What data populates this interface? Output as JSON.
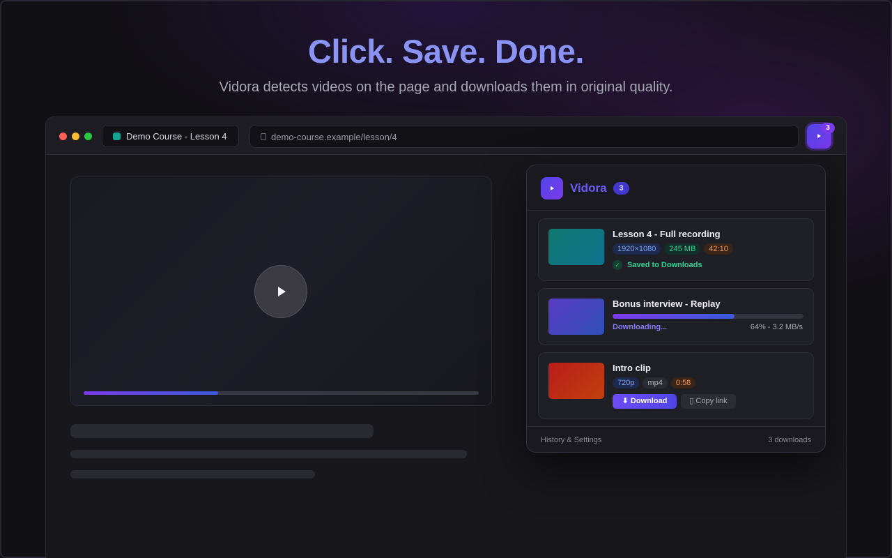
{
  "hero": {
    "title": "Click. Save. Done.",
    "subtitle": "Vidora detects videos on the page and downloads them in original quality."
  },
  "browser": {
    "tab_title": "Demo Course - Lesson 4",
    "url": "demo-course.example/lesson/4",
    "extension_badge": "3"
  },
  "player": {
    "progress_fraction": 0.34
  },
  "popup": {
    "brand": "Vidora",
    "count": "3",
    "items": [
      {
        "title": "Lesson 4 - Full recording",
        "resolution": "1920×1080",
        "size": "245 MB",
        "duration": "42:10",
        "status": "Saved to Downloads",
        "check": "✓"
      },
      {
        "title": "Bonus interview - Replay",
        "status": "Downloading...",
        "rate": "64% - 3.2 MB/s",
        "progress_fraction": 0.64
      },
      {
        "title": "Intro clip",
        "resolution": "720p",
        "format": "mp4",
        "duration": "0:58",
        "download_label": "⬇ Download",
        "copy_label": "▯ Copy link"
      }
    ],
    "footer_left": "History & Settings",
    "footer_right": "3 downloads"
  },
  "colors": {
    "accent": "#6d5cf0",
    "success": "#34d399",
    "warning": "#f39a5b",
    "thumb_1": "#0f766e",
    "thumb_2": "#5b3cc4",
    "thumb_3": "#c2410c"
  },
  "icons": [
    "play-icon",
    "lock-icon",
    "check-icon",
    "download-icon",
    "copy-icon"
  ]
}
